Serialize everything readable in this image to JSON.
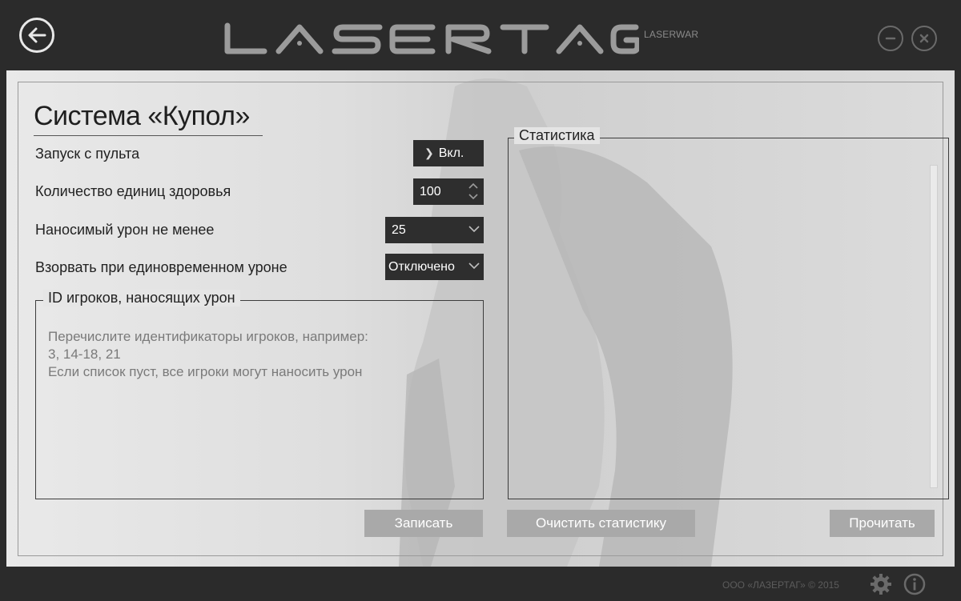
{
  "header": {
    "logo_text": "LASERTAG",
    "logo_sub": "LASERWAR"
  },
  "icons": {
    "back": "back-arrow-icon",
    "minimize": "minimize-icon",
    "close": "close-icon",
    "settings": "gear-icon",
    "info": "info-icon"
  },
  "page": {
    "title": "Система «Купол»"
  },
  "settings": {
    "remote_start_label": "Запуск с пульта",
    "remote_start_value": "Вкл.",
    "health_label": "Количество единиц здоровья",
    "health_value": "100",
    "min_damage_label": "Наносимый урон не менее",
    "min_damage_value": "25",
    "explode_label": "Взорвать при единовременном уроне",
    "explode_value": "Отключено"
  },
  "ids_group": {
    "legend": "ID игроков, наносящих урон",
    "placeholder": "Перечислите идентификаторы игроков, например:\n3, 14-18, 21\nЕсли список пуст, все игроки могут наносить урон"
  },
  "stats_group": {
    "legend": "Статистика"
  },
  "buttons": {
    "save": "Записать",
    "clear_stats": "Очистить статистику",
    "read": "Прочитать"
  },
  "footer": {
    "copyright": "ООО «ЛАЗЕРТАГ» © 2015"
  },
  "colors": {
    "header_bg": "#2b2b2b",
    "panel_bg": "#e9e9e9",
    "control_dark": "#2e2e2e",
    "button_gray": "#a9a9a9"
  }
}
